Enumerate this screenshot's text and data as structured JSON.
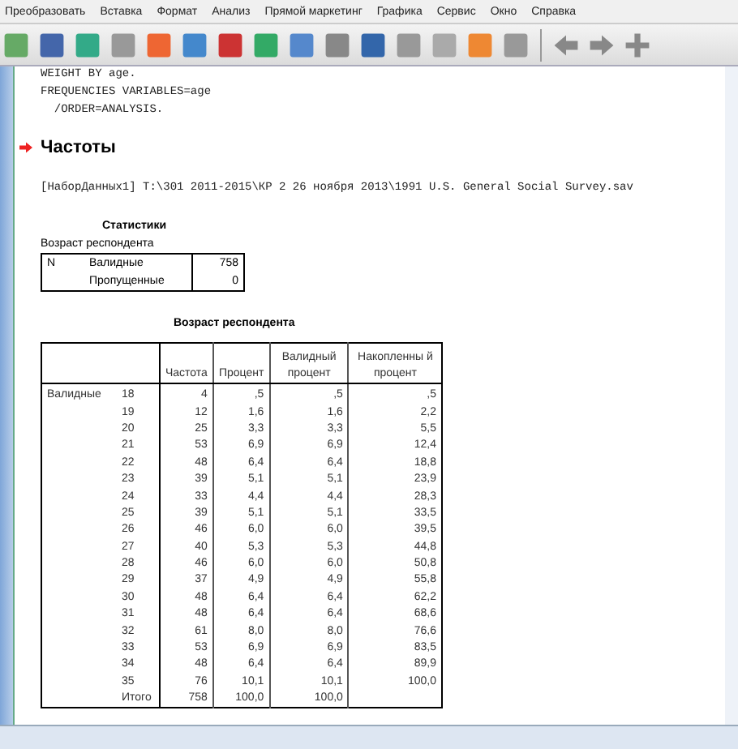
{
  "menu": [
    "Преобразовать",
    "Вставка",
    "Формат",
    "Анализ",
    "Прямой маркетинг",
    "Графика",
    "Сервис",
    "Окно",
    "Справка"
  ],
  "syntax": [
    "WEIGHT BY age.",
    "FREQUENCIES VARIABLES=age",
    "  /ORDER=ANALYSIS."
  ],
  "heading": "Частоты",
  "dataset": "[НаборДанных1] T:\\301 2011-2015\\КР 2 26 ноября 2013\\1991 U.S. General Social Survey.sav",
  "stats": {
    "title": "Статистики",
    "subtitle": "Возраст респондента",
    "n": "N",
    "rows": [
      {
        "label": "Валидные",
        "value": "758"
      },
      {
        "label": "Пропущенные",
        "value": "0"
      }
    ]
  },
  "freq": {
    "title": "Возраст респондента",
    "columns": [
      "Частота",
      "Процент",
      "Валидный процент",
      "Накопленны й процент"
    ],
    "group": "Валидные",
    "rows": [
      {
        "age": "18",
        "c": [
          "4",
          ",5",
          ",5",
          ",5"
        ]
      },
      {
        "age": "19",
        "c": [
          "12",
          "1,6",
          "1,6",
          "2,2"
        ]
      },
      {
        "age": "20",
        "c": [
          "25",
          "3,3",
          "3,3",
          "5,5"
        ]
      },
      {
        "age": "21",
        "c": [
          "53",
          "6,9",
          "6,9",
          "12,4"
        ]
      },
      {
        "age": "22",
        "c": [
          "48",
          "6,4",
          "6,4",
          "18,8"
        ]
      },
      {
        "age": "23",
        "c": [
          "39",
          "5,1",
          "5,1",
          "23,9"
        ]
      },
      {
        "age": "24",
        "c": [
          "33",
          "4,4",
          "4,4",
          "28,3"
        ]
      },
      {
        "age": "25",
        "c": [
          "39",
          "5,1",
          "5,1",
          "33,5"
        ]
      },
      {
        "age": "26",
        "c": [
          "46",
          "6,0",
          "6,0",
          "39,5"
        ]
      },
      {
        "age": "27",
        "c": [
          "40",
          "5,3",
          "5,3",
          "44,8"
        ]
      },
      {
        "age": "28",
        "c": [
          "46",
          "6,0",
          "6,0",
          "50,8"
        ]
      },
      {
        "age": "29",
        "c": [
          "37",
          "4,9",
          "4,9",
          "55,8"
        ]
      },
      {
        "age": "30",
        "c": [
          "48",
          "6,4",
          "6,4",
          "62,2"
        ]
      },
      {
        "age": "31",
        "c": [
          "48",
          "6,4",
          "6,4",
          "68,6"
        ]
      },
      {
        "age": "32",
        "c": [
          "61",
          "8,0",
          "8,0",
          "76,6"
        ]
      },
      {
        "age": "33",
        "c": [
          "53",
          "6,9",
          "6,9",
          "83,5"
        ]
      },
      {
        "age": "34",
        "c": [
          "48",
          "6,4",
          "6,4",
          "89,9"
        ]
      },
      {
        "age": "35",
        "c": [
          "76",
          "10,1",
          "10,1",
          "100,0"
        ]
      },
      {
        "age": "Итого",
        "c": [
          "758",
          "100,0",
          "100,0"
        ]
      }
    ]
  }
}
